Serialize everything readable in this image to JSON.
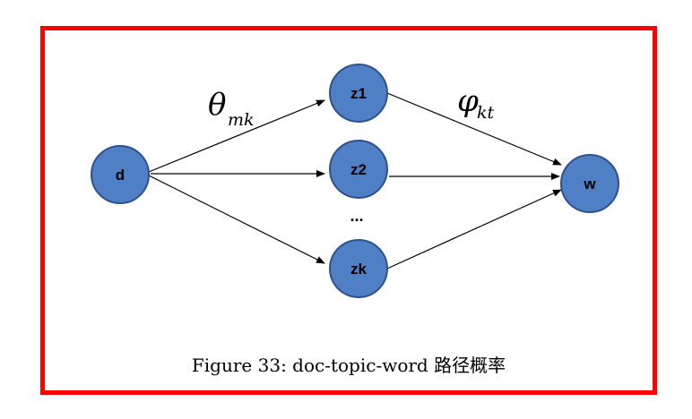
{
  "diagram": {
    "nodes": {
      "d": "d",
      "z1": "z1",
      "z2": "z2",
      "zk": "zk",
      "w": "w"
    },
    "ellipsis": "...",
    "edge_labels": {
      "theta_symbol": "θ",
      "theta_subscript": "mk",
      "phi_symbol": "φ",
      "phi_subscript": "kt"
    },
    "colors": {
      "node_fill": "#4f7fc4",
      "node_stroke": "#2f528f",
      "frame_border": "#ff0000"
    }
  },
  "caption": "Figure 33: doc-topic-word 路径概率"
}
